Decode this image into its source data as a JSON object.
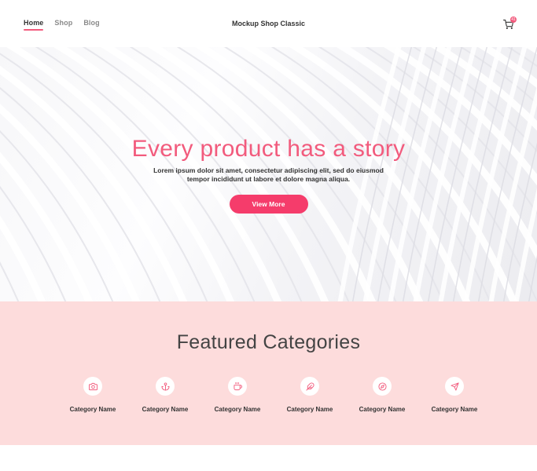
{
  "nav": {
    "items": [
      {
        "label": "Home",
        "active": true
      },
      {
        "label": "Shop",
        "active": false
      },
      {
        "label": "Blog",
        "active": false
      }
    ]
  },
  "brand": {
    "name": "Mockup Shop Classic"
  },
  "cart": {
    "icon": "cart-icon",
    "count": "41"
  },
  "hero": {
    "title": "Every product has a story",
    "subtitle": "Lorem ipsum dolor sit amet, consectetur adipiscing elit, sed do eiusmod tempor incididunt ut labore et dolore magna aliqua.",
    "button_label": "View More"
  },
  "featured": {
    "title": "Featured Categories",
    "categories": [
      {
        "label": "Category Name",
        "icon": "camera-icon"
      },
      {
        "label": "Category Name",
        "icon": "anchor-icon"
      },
      {
        "label": "Category Name",
        "icon": "coffee-icon"
      },
      {
        "label": "Category Name",
        "icon": "feather-icon"
      },
      {
        "label": "Category Name",
        "icon": "compass-icon"
      },
      {
        "label": "Category Name",
        "icon": "send-icon"
      }
    ]
  },
  "colors": {
    "accent": "#f25b7d",
    "button": "#f53c6b",
    "featured_bg": "#fddcdc"
  }
}
